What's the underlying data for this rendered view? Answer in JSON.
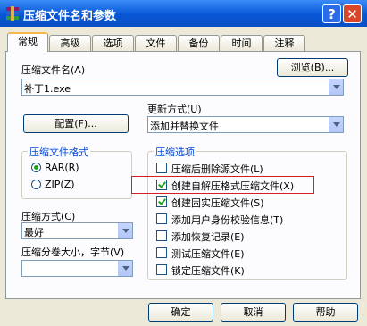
{
  "title": "压缩文件名和参数",
  "tabs": [
    "常规",
    "高级",
    "选项",
    "文件",
    "备份",
    "时间",
    "注释"
  ],
  "archive_name": {
    "label": "压缩文件名(A)",
    "value": "补丁1.exe",
    "browse_button": "浏览(B)..."
  },
  "update_mode": {
    "label": "更新方式(U)",
    "value": "添加并替换文件"
  },
  "profiles_button": "配置(F)...",
  "format_group": {
    "title": "压缩文件格式",
    "options": [
      "RAR(R)",
      "ZIP(Z)"
    ],
    "selected": "RAR(R)"
  },
  "method": {
    "label": "压缩方式(C)",
    "value": "最好"
  },
  "split": {
    "label": "压缩分卷大小，字节(V)",
    "value": ""
  },
  "options_group": {
    "title": "压缩选项",
    "items": [
      {
        "label": "压缩后删除源文件(L)",
        "checked": false
      },
      {
        "label": "创建自解压格式压缩文件(X)",
        "checked": true
      },
      {
        "label": "创建固实压缩文件(S)",
        "checked": true
      },
      {
        "label": "添加用户身份校验信息(T)",
        "checked": false
      },
      {
        "label": "添加恢复记录(E)",
        "checked": false
      },
      {
        "label": "测试压缩文件(E)",
        "checked": false
      },
      {
        "label": "锁定压缩文件(K)",
        "checked": false
      }
    ]
  },
  "buttons": {
    "ok": "确定",
    "cancel": "取消",
    "help": "帮助"
  },
  "titlebar_buttons": {
    "help": "?",
    "close": "✕"
  },
  "colors": {
    "title_bar": "#0856d6",
    "group_title": "#0046d5",
    "highlight_border": "#d42020",
    "check_mark": "#21a121"
  }
}
